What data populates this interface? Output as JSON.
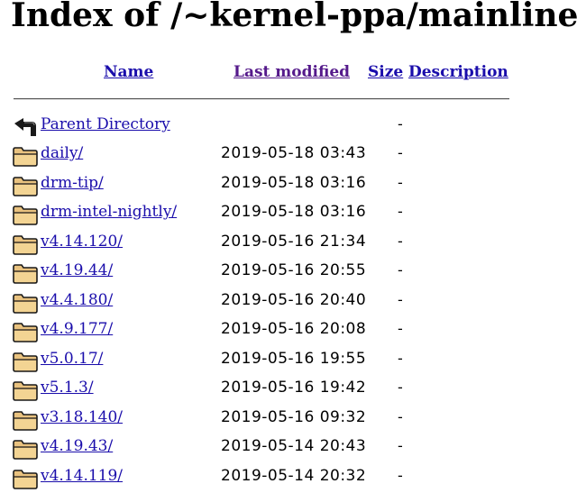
{
  "page": {
    "title": "Index of /~kernel-ppa/mainline"
  },
  "columns": {
    "name": "Name",
    "last_modified": "Last modified",
    "size": "Size",
    "description": "Description"
  },
  "parent": {
    "label": "Parent Directory",
    "size": "-",
    "icon": "back-arrow-icon"
  },
  "rows": [
    {
      "name": "daily/",
      "modified": "2019-05-18 03:43",
      "size": "-"
    },
    {
      "name": "drm-tip/",
      "modified": "2019-05-18 03:16",
      "size": "-"
    },
    {
      "name": "drm-intel-nightly/",
      "modified": "2019-05-18 03:16",
      "size": "-"
    },
    {
      "name": "v4.14.120/",
      "modified": "2019-05-16 21:34",
      "size": "-"
    },
    {
      "name": "v4.19.44/",
      "modified": "2019-05-16 20:55",
      "size": "-"
    },
    {
      "name": "v4.4.180/",
      "modified": "2019-05-16 20:40",
      "size": "-"
    },
    {
      "name": "v4.9.177/",
      "modified": "2019-05-16 20:08",
      "size": "-"
    },
    {
      "name": "v5.0.17/",
      "modified": "2019-05-16 19:55",
      "size": "-"
    },
    {
      "name": "v5.1.3/",
      "modified": "2019-05-16 19:42",
      "size": "-"
    },
    {
      "name": "v3.18.140/",
      "modified": "2019-05-16 09:32",
      "size": "-"
    },
    {
      "name": "v4.19.43/",
      "modified": "2019-05-14 20:43",
      "size": "-"
    },
    {
      "name": "v4.14.119/",
      "modified": "2019-05-14 20:32",
      "size": "-"
    }
  ],
  "icons": {
    "folder": "folder-icon"
  }
}
